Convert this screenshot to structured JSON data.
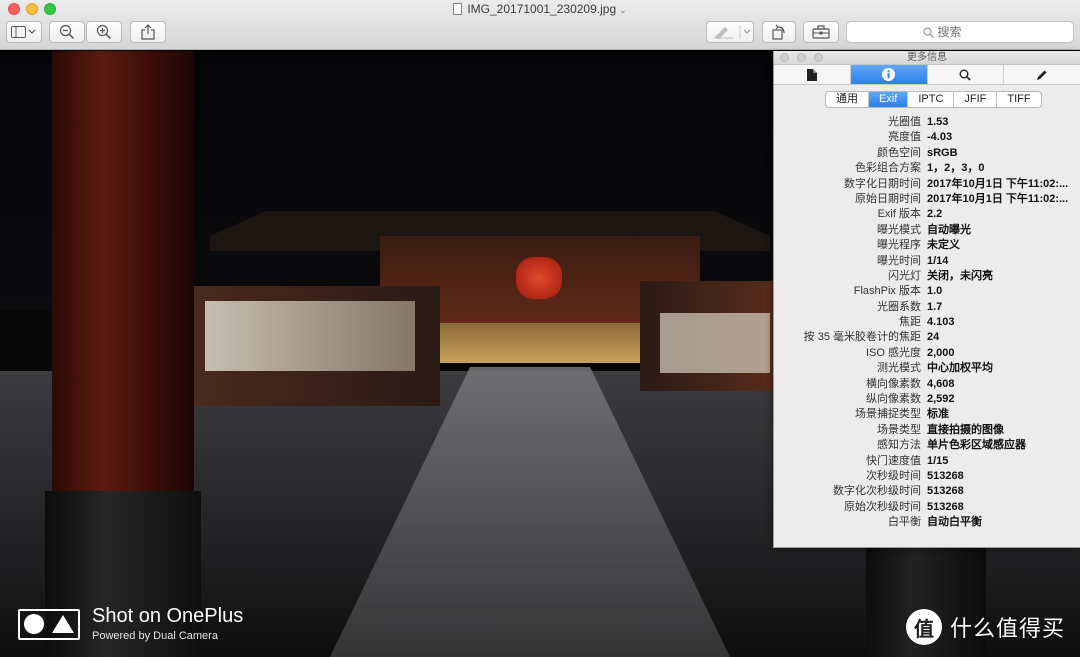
{
  "window": {
    "title": "IMG_20171001_230209.jpg"
  },
  "toolbar": {
    "search_placeholder": "搜索"
  },
  "photo_overlay": {
    "watermark_title": "Shot on OnePlus",
    "watermark_sub": "Powered by Dual Camera",
    "site_badge": "值",
    "site_name": "什么值得买"
  },
  "info_panel": {
    "title": "更多信息",
    "icon_tabs": [
      "document-icon",
      "info-icon",
      "magnifier-icon",
      "pencil-icon"
    ],
    "active_icon_tab": 1,
    "segments": [
      "通用",
      "Exif",
      "IPTC",
      "JFIF",
      "TIFF"
    ],
    "active_segment": 1,
    "rows": [
      {
        "k": "光圈值",
        "v": "1.53"
      },
      {
        "k": "亮度值",
        "v": "-4.03"
      },
      {
        "k": "颜色空间",
        "v": "sRGB"
      },
      {
        "k": "色彩组合方案",
        "v": "1，2，3，0"
      },
      {
        "k": "数字化日期时间",
        "v": "2017年10月1日 下午11:02:..."
      },
      {
        "k": "原始日期时间",
        "v": "2017年10月1日 下午11:02:..."
      },
      {
        "k": "Exif 版本",
        "v": "2.2"
      },
      {
        "k": "曝光模式",
        "v": "自动曝光"
      },
      {
        "k": "曝光程序",
        "v": "未定义"
      },
      {
        "k": "曝光时间",
        "v": "1/14"
      },
      {
        "k": "闪光灯",
        "v": "关闭，未闪亮"
      },
      {
        "k": "FlashPix 版本",
        "v": "1.0"
      },
      {
        "k": "光圈系数",
        "v": "1.7"
      },
      {
        "k": "焦距",
        "v": "4.103"
      },
      {
        "k": "按 35 毫米胶卷计的焦距",
        "v": "24"
      },
      {
        "k": "ISO 感光度",
        "v": "2,000"
      },
      {
        "k": "测光模式",
        "v": "中心加权平均"
      },
      {
        "k": "横向像素数",
        "v": "4,608"
      },
      {
        "k": "纵向像素数",
        "v": "2,592"
      },
      {
        "k": "场景捕捉类型",
        "v": "标准"
      },
      {
        "k": "场景类型",
        "v": "直接拍摄的图像"
      },
      {
        "k": "感知方法",
        "v": "单片色彩区域感应器"
      },
      {
        "k": "快门速度值",
        "v": "1/15"
      },
      {
        "k": "次秒级时间",
        "v": "513268"
      },
      {
        "k": "数字化次秒级时间",
        "v": "513268"
      },
      {
        "k": "原始次秒级时间",
        "v": "513268"
      },
      {
        "k": "白平衡",
        "v": "自动白平衡"
      }
    ]
  },
  "colors": {
    "accent": "#2b80ea"
  }
}
